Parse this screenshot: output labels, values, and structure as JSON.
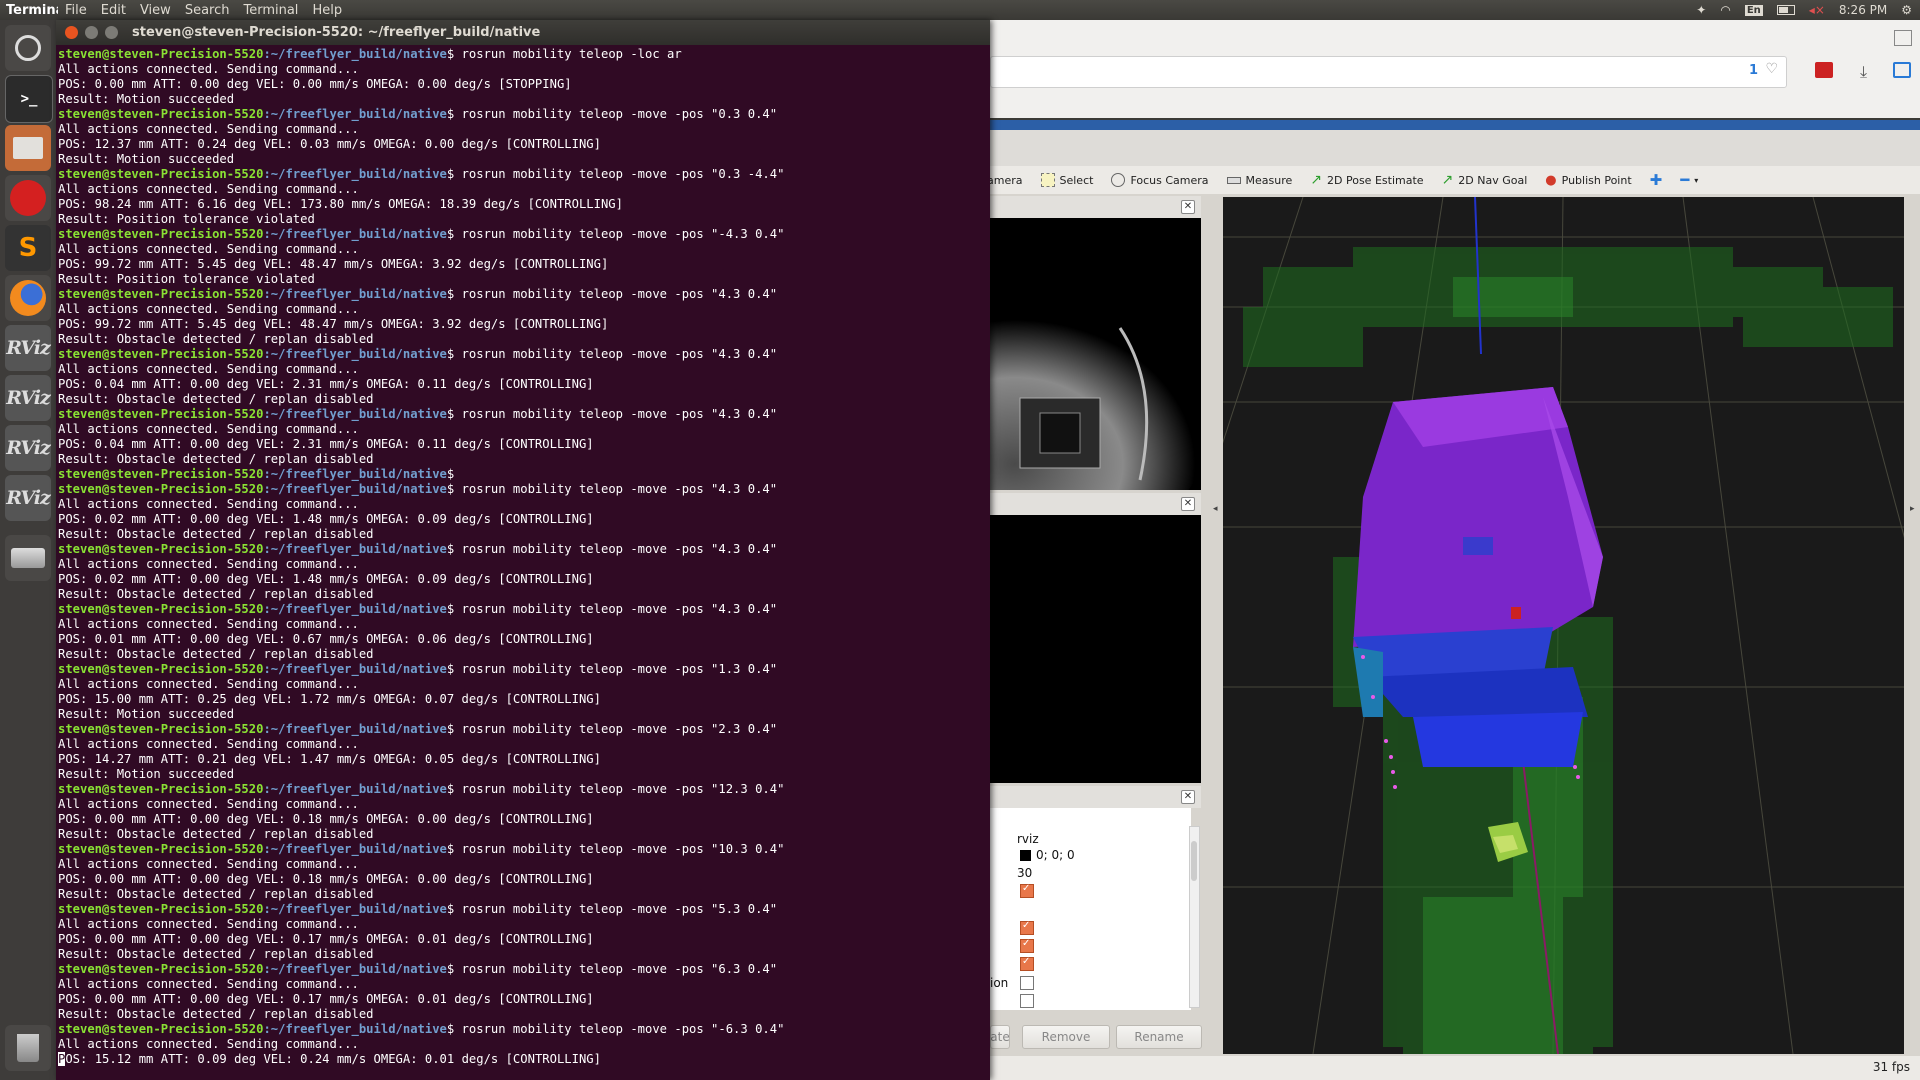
{
  "top_panel": {
    "app_name": "Terminal",
    "menus": [
      "Terminal",
      "File",
      "Edit",
      "View",
      "Search",
      "Terminal",
      "Help"
    ],
    "keyboard_layout": "En",
    "clock": "8:26 PM"
  },
  "launcher": {
    "items": [
      "ubuntu-dash",
      "terminal",
      "files",
      "red-app",
      "sublime-text",
      "firefox",
      "rviz",
      "rviz",
      "rviz",
      "rviz",
      "disk-drive",
      "trash"
    ],
    "rviz_label": "RViz",
    "sublime_label": "S"
  },
  "terminal": {
    "title": "steven@steven-Precision-5520: ~/freeflyer_build/native",
    "prompt_user": "steven@steven-Precision-5520",
    "prompt_path": ":~/freeflyer_build/native",
    "lines": [
      {
        "type": "prompt",
        "cmd": " rosrun mobility teleop -loc ar"
      },
      {
        "type": "out",
        "text": "All actions connected. Sending command..."
      },
      {
        "type": "out",
        "text": "POS: 0.00 mm ATT: 0.00 deg VEL: 0.00 mm/s OMEGA: 0.00 deg/s [STOPPING]"
      },
      {
        "type": "out",
        "text": "Result: Motion succeeded"
      },
      {
        "type": "prompt",
        "cmd": " rosrun mobility teleop -move -pos \"0.3 0.4\""
      },
      {
        "type": "out",
        "text": "All actions connected. Sending command..."
      },
      {
        "type": "out",
        "text": "POS: 12.37 mm ATT: 0.24 deg VEL: 0.03 mm/s OMEGA: 0.00 deg/s [CONTROLLING]"
      },
      {
        "type": "out",
        "text": "Result: Motion succeeded"
      },
      {
        "type": "prompt",
        "cmd": " rosrun mobility teleop -move -pos \"0.3 -4.4\""
      },
      {
        "type": "out",
        "text": "All actions connected. Sending command..."
      },
      {
        "type": "out",
        "text": "POS: 98.24 mm ATT: 6.16 deg VEL: 173.80 mm/s OMEGA: 18.39 deg/s [CONTROLLING]"
      },
      {
        "type": "out",
        "text": "Result: Position tolerance violated"
      },
      {
        "type": "prompt",
        "cmd": " rosrun mobility teleop -move -pos \"-4.3 0.4\""
      },
      {
        "type": "out",
        "text": "All actions connected. Sending command..."
      },
      {
        "type": "out",
        "text": "POS: 99.72 mm ATT: 5.45 deg VEL: 48.47 mm/s OMEGA: 3.92 deg/s [CONTROLLING]"
      },
      {
        "type": "out",
        "text": "Result: Position tolerance violated"
      },
      {
        "type": "prompt",
        "cmd": " rosrun mobility teleop -move -pos \"4.3 0.4\""
      },
      {
        "type": "out",
        "text": "All actions connected. Sending command..."
      },
      {
        "type": "out",
        "text": "POS: 99.72 mm ATT: 5.45 deg VEL: 48.47 mm/s OMEGA: 3.92 deg/s [CONTROLLING]"
      },
      {
        "type": "out",
        "text": "Result: Obstacle detected / replan disabled"
      },
      {
        "type": "prompt",
        "cmd": " rosrun mobility teleop -move -pos \"4.3 0.4\""
      },
      {
        "type": "out",
        "text": "All actions connected. Sending command..."
      },
      {
        "type": "out",
        "text": "POS: 0.04 mm ATT: 0.00 deg VEL: 2.31 mm/s OMEGA: 0.11 deg/s [CONTROLLING]"
      },
      {
        "type": "out",
        "text": "Result: Obstacle detected / replan disabled"
      },
      {
        "type": "prompt",
        "cmd": " rosrun mobility teleop -move -pos \"4.3 0.4\""
      },
      {
        "type": "out",
        "text": "All actions connected. Sending command..."
      },
      {
        "type": "out",
        "text": "POS: 0.04 mm ATT: 0.00 deg VEL: 2.31 mm/s OMEGA: 0.11 deg/s [CONTROLLING]"
      },
      {
        "type": "out",
        "text": "Result: Obstacle detected / replan disabled"
      },
      {
        "type": "prompt",
        "cmd": ""
      },
      {
        "type": "prompt",
        "cmd": " rosrun mobility teleop -move -pos \"4.3 0.4\""
      },
      {
        "type": "out",
        "text": "All actions connected. Sending command..."
      },
      {
        "type": "out",
        "text": "POS: 0.02 mm ATT: 0.00 deg VEL: 1.48 mm/s OMEGA: 0.09 deg/s [CONTROLLING]"
      },
      {
        "type": "out",
        "text": "Result: Obstacle detected / replan disabled"
      },
      {
        "type": "prompt",
        "cmd": " rosrun mobility teleop -move -pos \"4.3 0.4\""
      },
      {
        "type": "out",
        "text": "All actions connected. Sending command..."
      },
      {
        "type": "out",
        "text": "POS: 0.02 mm ATT: 0.00 deg VEL: 1.48 mm/s OMEGA: 0.09 deg/s [CONTROLLING]"
      },
      {
        "type": "out",
        "text": "Result: Obstacle detected / replan disabled"
      },
      {
        "type": "prompt",
        "cmd": " rosrun mobility teleop -move -pos \"4.3 0.4\""
      },
      {
        "type": "out",
        "text": "All actions connected. Sending command..."
      },
      {
        "type": "out",
        "text": "POS: 0.01 mm ATT: 0.00 deg VEL: 0.67 mm/s OMEGA: 0.06 deg/s [CONTROLLING]"
      },
      {
        "type": "out",
        "text": "Result: Obstacle detected / replan disabled"
      },
      {
        "type": "prompt",
        "cmd": " rosrun mobility teleop -move -pos \"1.3 0.4\""
      },
      {
        "type": "out",
        "text": "All actions connected. Sending command..."
      },
      {
        "type": "out",
        "text": "POS: 15.00 mm ATT: 0.25 deg VEL: 1.72 mm/s OMEGA: 0.07 deg/s [CONTROLLING]"
      },
      {
        "type": "out",
        "text": "Result: Motion succeeded"
      },
      {
        "type": "prompt",
        "cmd": " rosrun mobility teleop -move -pos \"2.3 0.4\""
      },
      {
        "type": "out",
        "text": "All actions connected. Sending command..."
      },
      {
        "type": "out",
        "text": "POS: 14.27 mm ATT: 0.21 deg VEL: 1.47 mm/s OMEGA: 0.05 deg/s [CONTROLLING]"
      },
      {
        "type": "out",
        "text": "Result: Motion succeeded"
      },
      {
        "type": "prompt",
        "cmd": " rosrun mobility teleop -move -pos \"12.3 0.4\""
      },
      {
        "type": "out",
        "text": "All actions connected. Sending command..."
      },
      {
        "type": "out",
        "text": "POS: 0.00 mm ATT: 0.00 deg VEL: 0.18 mm/s OMEGA: 0.00 deg/s [CONTROLLING]"
      },
      {
        "type": "out",
        "text": "Result: Obstacle detected / replan disabled"
      },
      {
        "type": "prompt",
        "cmd": " rosrun mobility teleop -move -pos \"10.3 0.4\""
      },
      {
        "type": "out",
        "text": "All actions connected. Sending command..."
      },
      {
        "type": "out",
        "text": "POS: 0.00 mm ATT: 0.00 deg VEL: 0.18 mm/s OMEGA: 0.00 deg/s [CONTROLLING]"
      },
      {
        "type": "out",
        "text": "Result: Obstacle detected / replan disabled"
      },
      {
        "type": "prompt",
        "cmd": " rosrun mobility teleop -move -pos \"5.3 0.4\""
      },
      {
        "type": "out",
        "text": "All actions connected. Sending command..."
      },
      {
        "type": "out",
        "text": "POS: 0.00 mm ATT: 0.00 deg VEL: 0.17 mm/s OMEGA: 0.01 deg/s [CONTROLLING]"
      },
      {
        "type": "out",
        "text": "Result: Obstacle detected / replan disabled"
      },
      {
        "type": "prompt",
        "cmd": " rosrun mobility teleop -move -pos \"6.3 0.4\""
      },
      {
        "type": "out",
        "text": "All actions connected. Sending command..."
      },
      {
        "type": "out",
        "text": "POS: 0.00 mm ATT: 0.00 deg VEL: 0.17 mm/s OMEGA: 0.01 deg/s [CONTROLLING]"
      },
      {
        "type": "out",
        "text": "Result: Obstacle detected / replan disabled"
      },
      {
        "type": "prompt",
        "cmd": " rosrun mobility teleop -move -pos \"-6.3 0.4\""
      },
      {
        "type": "out",
        "text": "All actions connected. Sending command..."
      },
      {
        "type": "cursor",
        "first": "P",
        "text": "OS: 15.12 mm ATT: 0.09 deg VEL: 0.24 mm/s OMEGA: 0.01 deg/s [CONTROLLING]"
      }
    ]
  },
  "browser": {
    "badge_count": "1",
    "ext_badge": "1"
  },
  "rviz": {
    "tools": [
      {
        "label": "amera",
        "icon": "camera-icon"
      },
      {
        "label": "Select",
        "icon": "select-icon"
      },
      {
        "label": "Focus Camera",
        "icon": "focus-camera-icon"
      },
      {
        "label": "Measure",
        "icon": "measure-icon"
      },
      {
        "label": "2D Pose Estimate",
        "icon": "pose-estimate-icon"
      },
      {
        "label": "2D Nav Goal",
        "icon": "nav-goal-icon"
      },
      {
        "label": "Publish Point",
        "icon": "publish-point-icon"
      }
    ],
    "displays": {
      "fixed_frame": "rviz",
      "background_color": "0; 0; 0",
      "frame_rate": "30",
      "partial_label": "ion"
    },
    "buttons": {
      "add_partial": "ate",
      "remove": "Remove",
      "rename": "Rename"
    },
    "fps": "31 fps",
    "colors": {
      "terminal_bg": "#300a24",
      "prompt_user": "#8ae234",
      "prompt_path": "#729fcf",
      "voxel_top": "#8a2be2",
      "voxel_mid": "#1e3fd6",
      "free_space": "#1f7a1f"
    }
  }
}
